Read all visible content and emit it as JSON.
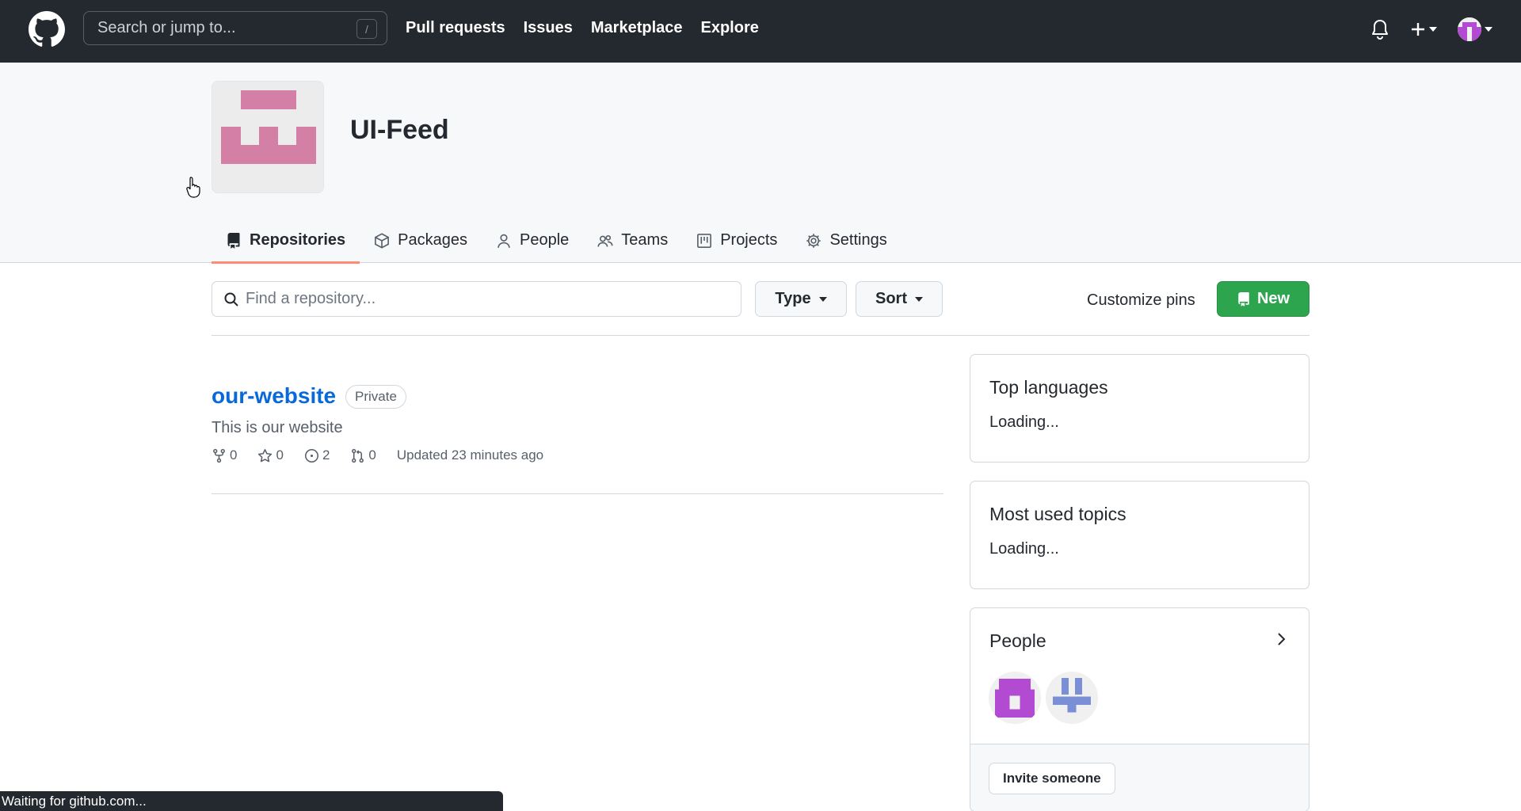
{
  "header": {
    "search_placeholder": "Search or jump to...",
    "search_shortcut": "/",
    "nav": [
      "Pull requests",
      "Issues",
      "Marketplace",
      "Explore"
    ]
  },
  "org": {
    "name": "UI-Feed",
    "tabs": [
      {
        "label": "Repositories",
        "icon": "repo-icon",
        "active": true
      },
      {
        "label": "Packages",
        "icon": "package-icon",
        "active": false
      },
      {
        "label": "People",
        "icon": "person-icon",
        "active": false
      },
      {
        "label": "Teams",
        "icon": "people-icon",
        "active": false
      },
      {
        "label": "Projects",
        "icon": "project-icon",
        "active": false
      },
      {
        "label": "Settings",
        "icon": "gear-icon",
        "active": false
      }
    ]
  },
  "filters": {
    "find_placeholder": "Find a repository...",
    "type_label": "Type",
    "sort_label": "Sort",
    "customize_label": "Customize pins",
    "new_label": "New"
  },
  "repos": [
    {
      "name": "our-website",
      "visibility": "Private",
      "description": "This is our website",
      "forks": "0",
      "stars": "0",
      "issues": "2",
      "pull_requests": "0",
      "updated": "Updated 23 minutes ago"
    }
  ],
  "sidebar": {
    "top_languages": {
      "title": "Top languages",
      "status": "Loading..."
    },
    "topics": {
      "title": "Most used topics",
      "status": "Loading..."
    },
    "people": {
      "title": "People",
      "invite_label": "Invite someone"
    }
  },
  "status_bar": "Waiting for github.com...",
  "colors": {
    "header_bg": "#24292f",
    "accent_new": "#2da44e",
    "link": "#0969da",
    "tab_underline": "#fd8c73",
    "org_avatar": "#d47fa6"
  }
}
